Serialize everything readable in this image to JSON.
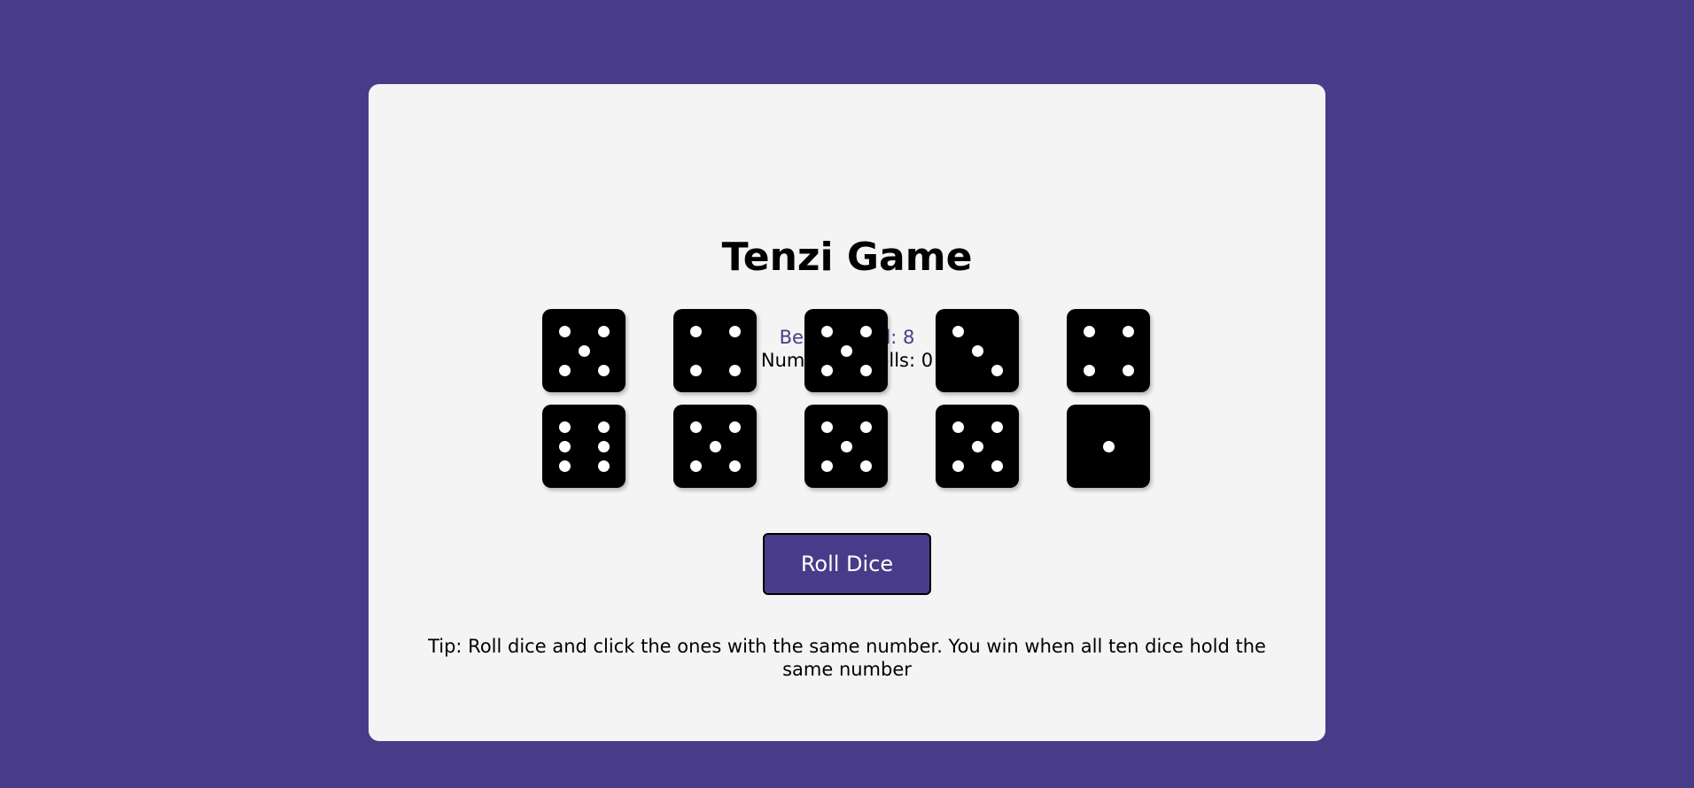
{
  "colors": {
    "background": "#483C8A",
    "card": "#F4F4F4",
    "accent": "#483C8A",
    "die": "#000000",
    "pip": "#FFFFFF"
  },
  "title": "Tenzi Game",
  "best_record": "Best Record: 8",
  "rolls": "Number of Rolls: 0",
  "dice": [
    5,
    4,
    5,
    3,
    4,
    6,
    5,
    5,
    5,
    1
  ],
  "roll_button": "Roll Dice",
  "tip": "Tip: Roll dice and click the ones with the same number. You win when all ten dice hold the same number"
}
